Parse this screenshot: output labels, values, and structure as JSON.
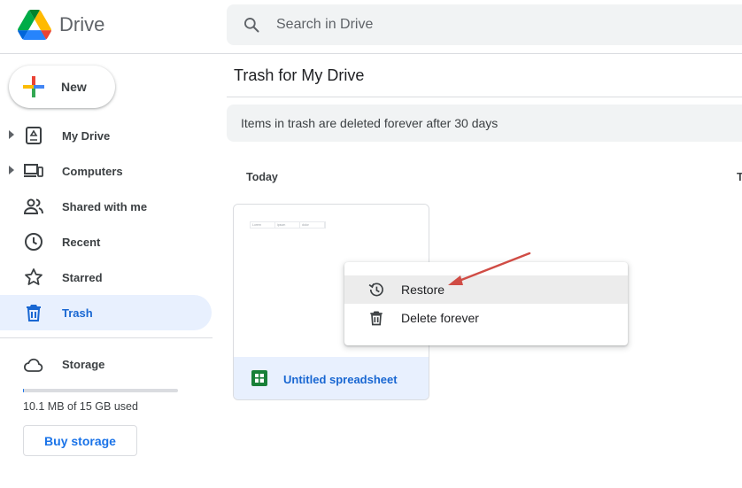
{
  "app": {
    "name": "Drive"
  },
  "search": {
    "placeholder": "Search in Drive"
  },
  "sidebar": {
    "new_label": "New",
    "items": [
      {
        "label": "My Drive",
        "icon": "my-drive-icon",
        "expandable": true
      },
      {
        "label": "Computers",
        "icon": "computers-icon",
        "expandable": true
      },
      {
        "label": "Shared with me",
        "icon": "shared-with-me-icon",
        "expandable": false
      },
      {
        "label": "Recent",
        "icon": "clock-icon",
        "expandable": false
      },
      {
        "label": "Starred",
        "icon": "star-icon",
        "expandable": false
      },
      {
        "label": "Trash",
        "icon": "trash-icon",
        "expandable": false,
        "active": true
      }
    ],
    "storage": {
      "label": "Storage",
      "used_text": "10.1 MB of 15 GB used",
      "used_fraction": 0.0007,
      "buy_label": "Buy storage"
    }
  },
  "main": {
    "title": "Trash for My Drive",
    "banner": "Items in trash are deleted forever after 30 days",
    "section_label": "Today",
    "section_label_2": "T",
    "file": {
      "name": "Untitled spreadsheet",
      "type_icon": "google-sheets-icon",
      "preview_cells": [
        "Lorem",
        "ipsum",
        "dolor"
      ]
    }
  },
  "context_menu": {
    "items": [
      {
        "label": "Restore",
        "icon": "restore-icon",
        "hovered": true
      },
      {
        "label": "Delete forever",
        "icon": "trash-icon"
      }
    ]
  },
  "colors": {
    "accent": "#1a73e8",
    "active_bg": "#e8f0fe",
    "active_text": "#1967d2",
    "annotation_arrow": "#d04c45"
  }
}
